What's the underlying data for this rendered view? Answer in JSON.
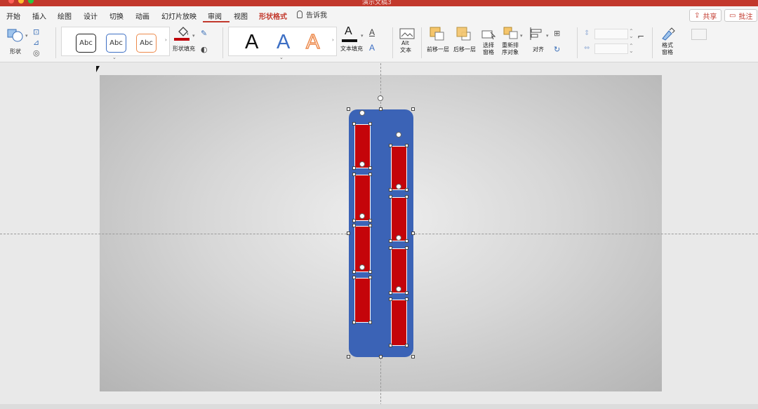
{
  "app": {
    "doc_title": "演示文稿3",
    "accent": "#c2382c"
  },
  "tabs": [
    "开始",
    "插入",
    "绘图",
    "设计",
    "切换",
    "动画",
    "幻灯片放映",
    "审阅",
    "视图",
    "形状格式"
  ],
  "active_tab": "审阅",
  "format_tab": "形状格式",
  "tell_me": "告诉我",
  "share_label": "共享",
  "comment_label": "批注",
  "ribbon": {
    "shape_label": "形状",
    "style_samples": [
      "Abc",
      "Abc",
      "Abc"
    ],
    "fill_label": "形状填充",
    "wordart_samples": [
      "A",
      "A",
      "A"
    ],
    "text_fill_label": "文本填充",
    "alt_text_label_1": "Alt",
    "alt_text_label_2": "文本",
    "bring_forward": "前移一层",
    "send_backward": "后移一层",
    "selection_pane_1": "选择",
    "selection_pane_2": "窗格",
    "reorder_1": "重新排",
    "reorder_2": "序对象",
    "align": "对齐",
    "format_pane_1": "格式",
    "format_pane_2": "窗格"
  },
  "colors": {
    "shape_blue": "#3b63b6",
    "rect_red": "#c4040a",
    "fill_swatch": "#c0040a",
    "text_fill_swatch": "#111111",
    "wordart_blue": "#3d6fc4",
    "wordart_orange": "#ed8a4c"
  }
}
